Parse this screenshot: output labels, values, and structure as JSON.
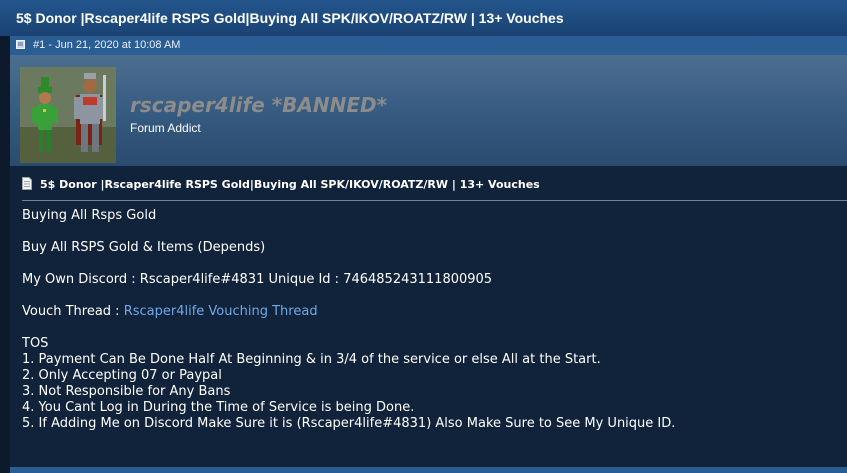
{
  "thread": {
    "title": "5$ Donor |Rscaper4life RSPS Gold|Buying All SPK/IKOV/ROATZ/RW | 13+ Vouches"
  },
  "post": {
    "meta": "#1 - Jun 21, 2020 at 10:08 AM",
    "title": "5$ Donor |Rscaper4life RSPS Gold|Buying All SPK/IKOV/ROATZ/RW | 13+ Vouches",
    "lines": {
      "buying": "Buying All Rsps Gold",
      "buy_items": "Buy All RSPS Gold & Items (Depends)",
      "discord": "My Own Discord : Rscaper4life#4831 Unique Id : 746485243111800905",
      "vouch_prefix": "Vouch Thread : ",
      "vouch_link": "Rscaper4life Vouching Thread",
      "tos_heading": "TOS",
      "tos1": "1. Payment Can Be Done Half At Beginning & in 3/4 of the service or else All at the Start.",
      "tos2": "2. Only Accepting 07 or Paypal",
      "tos3": "3. Not Responsible for Any Bans",
      "tos4": "4. You Cant Log in During the Time of Service is being Done.",
      "tos5": "5. If Adding Me on Discord Make Sure it is (Rscaper4life#4831) Also Make Sure to See My Unique ID."
    }
  },
  "user": {
    "name": "rscaper4life *BANNED*",
    "title": "Forum Addict"
  },
  "icons": {
    "post": "post-icon",
    "document": "document-icon",
    "avatar": "avatar-image"
  },
  "colors": {
    "header": "#1f4e82",
    "link": "#6fa8e6",
    "banned_name": "#8c8c8c",
    "body_bg": "#11233a"
  }
}
